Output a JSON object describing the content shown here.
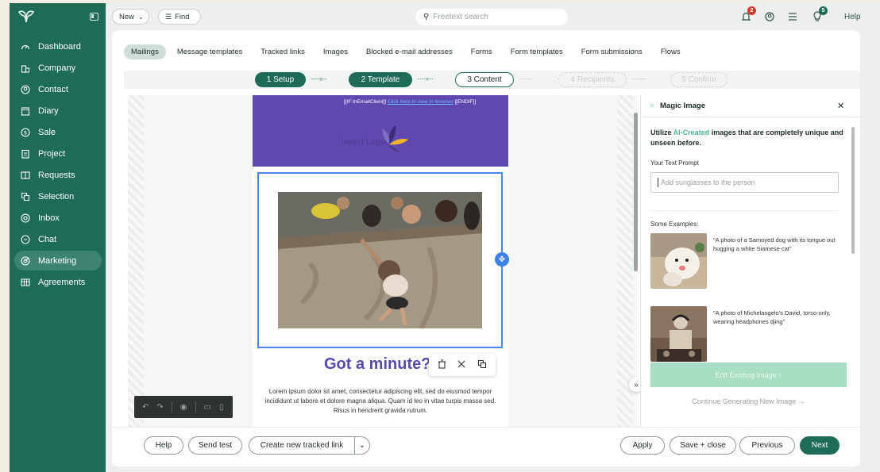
{
  "sidebar": {
    "items": [
      {
        "label": "Dashboard",
        "icon": "dashboard-icon"
      },
      {
        "label": "Company",
        "icon": "company-icon"
      },
      {
        "label": "Contact",
        "icon": "contact-icon"
      },
      {
        "label": "Diary",
        "icon": "diary-icon"
      },
      {
        "label": "Sale",
        "icon": "sale-icon"
      },
      {
        "label": "Project",
        "icon": "project-icon"
      },
      {
        "label": "Requests",
        "icon": "requests-icon"
      },
      {
        "label": "Selection",
        "icon": "selection-icon"
      },
      {
        "label": "Inbox",
        "icon": "inbox-icon"
      },
      {
        "label": "Chat",
        "icon": "chat-icon"
      },
      {
        "label": "Marketing",
        "icon": "marketing-icon",
        "active": true
      },
      {
        "label": "Agreements",
        "icon": "agreements-icon"
      }
    ]
  },
  "topbar": {
    "new_label": "New",
    "find_label": "Find",
    "search_placeholder": "Freetext search",
    "notifications_count": "2",
    "tips_count": "5",
    "help_label": "Help"
  },
  "tabs": [
    "Mailings",
    "Message templates",
    "Tracked links",
    "Images",
    "Blocked e-mail addresses",
    "Forms",
    "Form templates",
    "Form submissions",
    "Flows"
  ],
  "steps": [
    "1 Setup",
    "2 Template",
    "3 Content",
    "4 Recipients",
    "5 Confirm"
  ],
  "email": {
    "top_prefix": "[[IF:InEmailClient]]",
    "top_link": "Click here to view in browser",
    "top_suffix": "[[ENDIF]]",
    "logo_text": "Insert Logo",
    "headline": "Got a minute?",
    "body": "Lorem ipsum dolor sit amet, consectetur adipiscing elit, sed do eiusmod tempor incididunt ut labore et dolore magna aliqua. Quam id leo in vitae turpis massa sed. Risus in hendrerit gravida rutrum."
  },
  "panel": {
    "title": "Magic Image",
    "intro_prefix": "Utilize ",
    "intro_ai": "AI-Created",
    "intro_suffix": " images that are completely unique and unseen before.",
    "prompt_label": "Your Text Prompt",
    "prompt_placeholder": "Add sunglasses to the person",
    "examples_label": "Some Examples:",
    "examples": [
      "\"A photo of a Samoyed dog with its tongue out hugging a white Siamese cat\"",
      "\"A photo of Michelangelo's David, torso-only, wearing headphones djing\""
    ],
    "edit_button": "Edit Existing Image ↑",
    "generate_link": "Continue Generating New Image →"
  },
  "footer": {
    "help": "Help",
    "send_test": "Send test",
    "create_link": "Create new tracked link",
    "apply": "Apply",
    "save_close": "Save + close",
    "previous": "Previous",
    "next": "Next"
  },
  "colors": {
    "brand": "#1e6b57",
    "email_header": "#5f49b0",
    "headline": "#5a49a8",
    "ai_accent": "#4cb88a",
    "badge_red": "#d63a2f",
    "badge_green": "#1e6b57"
  }
}
